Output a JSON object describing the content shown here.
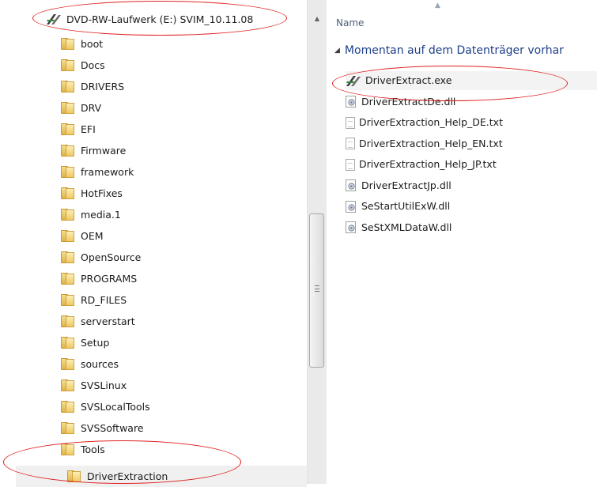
{
  "tree": {
    "drive_label": "DVD-RW-Laufwerk (E:) SVIM_10.11.08",
    "folders": [
      "boot",
      "Docs",
      "DRIVERS",
      "DRV",
      "EFI",
      "Firmware",
      "framework",
      "HotFixes",
      "media.1",
      "OEM",
      "OpenSource",
      "PROGRAMS",
      "RD_FILES",
      "serverstart",
      "Setup",
      "sources",
      "SVSLinux",
      "SVSLocalTools",
      "SVSSoftware",
      "Tools"
    ],
    "subfolder": "DriverExtraction"
  },
  "content": {
    "column_name": "Name",
    "group_header": "Momentan auf dem Datenträger vorhar",
    "files": [
      {
        "name": "DriverExtract.exe",
        "icon": "exe-icon"
      },
      {
        "name": "DriverExtractDe.dll",
        "icon": "dll-icon"
      },
      {
        "name": "DriverExtraction_Help_DE.txt",
        "icon": "txt-icon"
      },
      {
        "name": "DriverExtraction_Help_EN.txt",
        "icon": "txt-icon"
      },
      {
        "name": "DriverExtraction_Help_JP.txt",
        "icon": "txt-icon"
      },
      {
        "name": "DriverExtractJp.dll",
        "icon": "dll-icon"
      },
      {
        "name": "SeStartUtilExW.dll",
        "icon": "dll-icon"
      },
      {
        "name": "SeStXMLDataW.dll",
        "icon": "dll-icon"
      }
    ]
  },
  "colors": {
    "annotation": "#e02020",
    "group_header": "#1e3f8a",
    "folder": "#edc966"
  }
}
